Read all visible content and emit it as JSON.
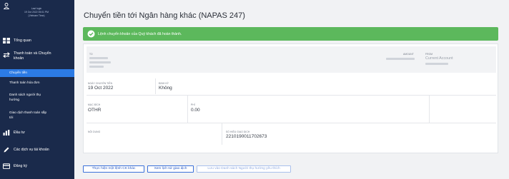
{
  "sidebar": {
    "user": {
      "lines": [
        "Last login",
        "19 Oct 2022 05:01 PM",
        "(Vietnam Time)"
      ]
    },
    "items": [
      {
        "label": "Tổng quan",
        "icon": "dashboard-icon"
      },
      {
        "label_line1": "Thanh toán và Chuyển",
        "label_line2": "khoản",
        "icon": "transfer-icon"
      },
      {
        "label": "Đầu tư",
        "icon": "chart-icon"
      },
      {
        "label": "Các dịch vụ tài khoản",
        "icon": "pen-icon"
      },
      {
        "label": "Đăng ký",
        "icon": "card-icon"
      }
    ],
    "sub_items": [
      {
        "label": "Chuyển tiền",
        "active": true
      },
      {
        "label": "Thanh toán hóa đơn"
      },
      {
        "label_line1": "Danh sách người thụ",
        "label_line2": "hưởng"
      },
      {
        "label_line1": "Giao dịch thanh toán sắp",
        "label_line2": "tới"
      }
    ]
  },
  "page": {
    "title": "Chuyển tiền tới Ngân hàng khác (NAPAS 247)"
  },
  "alert": {
    "text": "Lệnh chuyển khoản của Quý khách đã hoàn thành."
  },
  "details": {
    "top_labels": {
      "to": "TO",
      "amount": "AMOUNT",
      "from": "FROM"
    },
    "from_account": "Current Account",
    "transfer_date_label": "NGÀY CHUYỂN TIỀN",
    "transfer_date": "19 Oct 2022",
    "recurring_label": "ĐỊNH KỲ",
    "recurring": "Không",
    "purpose_label": "MỤC ĐÍCH",
    "purpose": "OTHR",
    "fee_label": "PHÍ",
    "fee": "0.00",
    "content_label": "NỘI DUNG",
    "txn_no_label": "SỐ HIỆU GIAO DỊCH",
    "txn_no": "2210190011702673"
  },
  "actions": {
    "new_transfer": "Thực hiện một lệnh CK khác",
    "history": "Xem lịch sử giao dịch",
    "save_beneficiary": "Lưu vào Danh sách Người thụ hưởng yêu thích"
  },
  "colors": {
    "sidebar": "#1a2a4b",
    "active": "#2c7be5",
    "success": "#5cb85c",
    "link": "#2457c5"
  }
}
